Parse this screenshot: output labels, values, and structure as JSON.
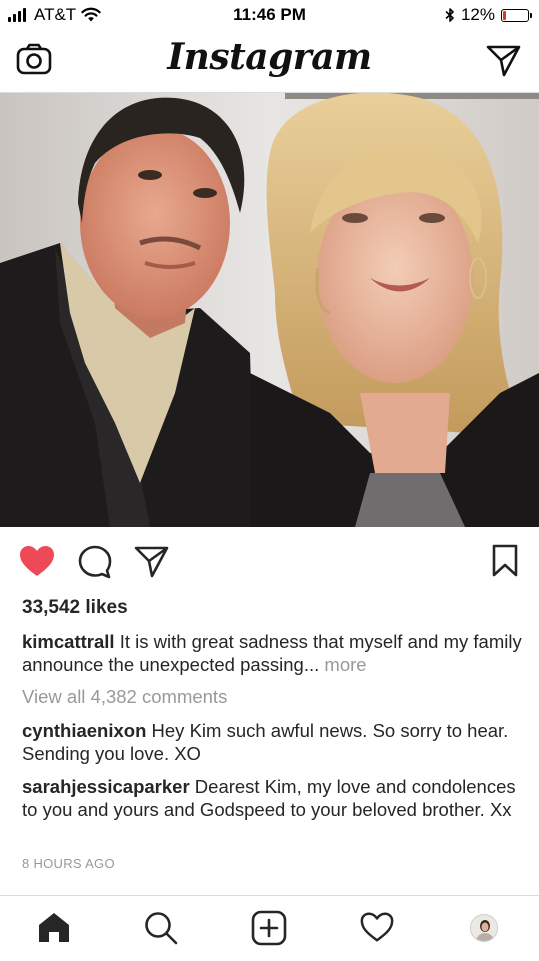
{
  "status_bar": {
    "carrier": "AT&T",
    "time": "11:46 PM",
    "battery": "12%",
    "battery_level": 0.12
  },
  "header": {
    "logo": "Instagram",
    "camera_icon": "camera-icon",
    "direct_icon": "paper-plane-icon"
  },
  "post": {
    "photo_icon": "photo",
    "liked": true,
    "likes": "33,542 likes",
    "caption": {
      "user": "kimcattrall",
      "text": "It is with great sadness that myself and my family announce the unexpected passing...",
      "more": "more"
    },
    "view_all": "View all 4,382 comments",
    "comments": [
      {
        "user": "cynthiaenixon",
        "text": "Hey Kim such awful news. So sorry to hear. Sending you love. XO"
      },
      {
        "user": "sarahjessicaparker",
        "text": "Dearest Kim, my love and condolences to you and yours and Godspeed to your beloved brother. Xx"
      }
    ],
    "time_ago": "8 HOURS AGO"
  },
  "colors": {
    "heart": "#ed4956",
    "muted": "#999999",
    "text": "#262626"
  },
  "tab_bar": [
    "home-icon",
    "search-icon",
    "new-post-icon",
    "activity-heart-icon",
    "profile-avatar"
  ]
}
